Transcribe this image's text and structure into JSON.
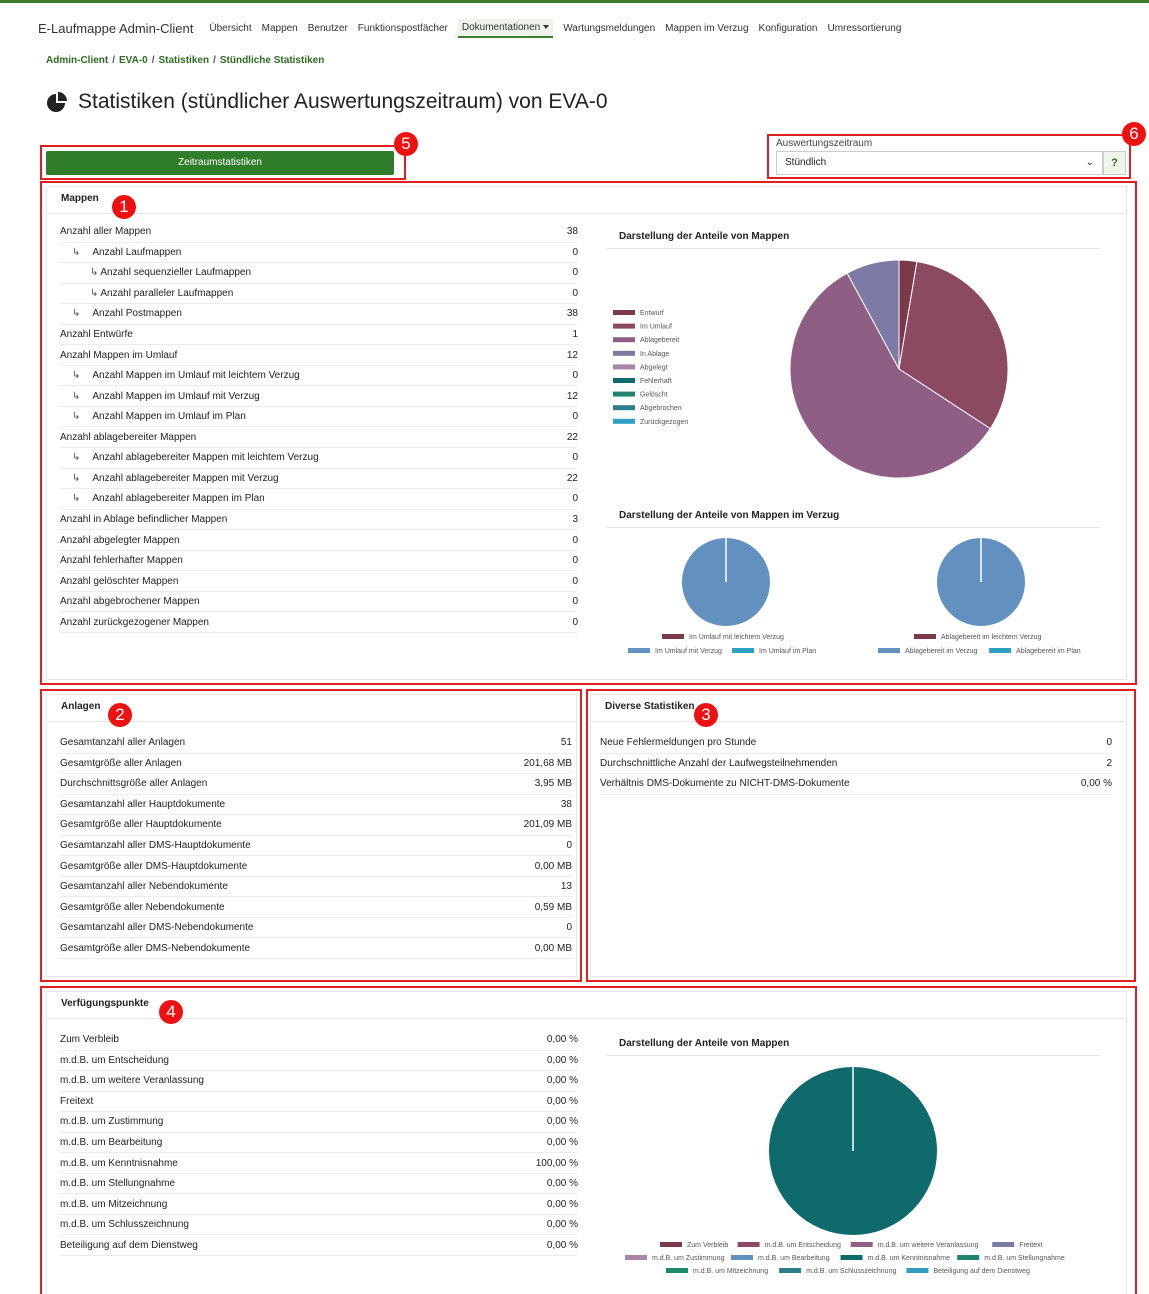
{
  "nav": {
    "brand": "E-Laufmappe Admin-Client",
    "items": [
      "Übersicht",
      "Mappen",
      "Benutzer",
      "Funktionspostfächer",
      "Dokumentationen",
      "Wartungsmeldungen",
      "Mappen im Verzug",
      "Konfiguration",
      "Umressortierung"
    ],
    "active_index": 4
  },
  "breadcrumb": [
    "Admin-Client",
    "EVA-0",
    "Statistiken",
    "Stündliche Statistiken"
  ],
  "page_title": "Statistiken (stündlicher Auswertungszeitraum) von EVA-0",
  "buttons": {
    "period_stats": "Zeitraumstatistiken"
  },
  "period": {
    "label": "Auswertungszeitraum",
    "value": "Stündlich",
    "help": "?"
  },
  "markers": [
    "1",
    "2",
    "3",
    "4",
    "5",
    "6"
  ],
  "colors": {
    "accent": "#2f7d2b",
    "highlight": "#e02020",
    "pie_1": [
      "#7b3a4a",
      "#8b4a62",
      "#8e5e85",
      "#7e7aa6",
      "#a985a8",
      "#0f6b6b",
      "#21846f",
      "#2d7d8c",
      "#2fa0c1"
    ],
    "pie_2": [
      "#7b3a4a",
      "#6291bf",
      "#2fa0c1"
    ],
    "pie_4": [
      "#7b3a4a",
      "#8b4a62",
      "#8e5e85",
      "#7e7aa6",
      "#a985a8",
      "#6291bf",
      "#0f6b6b",
      "#21846f",
      "#1f8a6a",
      "#2d7d8c",
      "#2fa0c1"
    ]
  },
  "mappen": {
    "header": "Mappen",
    "rows": [
      {
        "label": "Anzahl aller Mappen",
        "value": "38",
        "indent": 0
      },
      {
        "label": "Anzahl Laufmappen",
        "value": "0",
        "indent": 1
      },
      {
        "label": "Anzahl sequenzieller Laufmappen",
        "value": "0",
        "indent": 2
      },
      {
        "label": "Anzahl paralleler Laufmappen",
        "value": "0",
        "indent": 2
      },
      {
        "label": "Anzahl Postmappen",
        "value": "38",
        "indent": 1
      },
      {
        "label": "Anzahl Entwürfe",
        "value": "1",
        "indent": 0
      },
      {
        "label": "Anzahl Mappen im Umlauf",
        "value": "12",
        "indent": 0
      },
      {
        "label": "Anzahl Mappen im Umlauf mit leichtem Verzug",
        "value": "0",
        "indent": 1
      },
      {
        "label": "Anzahl Mappen im Umlauf mit Verzug",
        "value": "12",
        "indent": 1
      },
      {
        "label": "Anzahl Mappen im Umlauf im Plan",
        "value": "0",
        "indent": 1
      },
      {
        "label": "Anzahl ablagebereiter Mappen",
        "value": "22",
        "indent": 0
      },
      {
        "label": "Anzahl ablagebereiter Mappen mit leichtem Verzug",
        "value": "0",
        "indent": 1
      },
      {
        "label": "Anzahl ablagebereiter Mappen mit Verzug",
        "value": "22",
        "indent": 1
      },
      {
        "label": "Anzahl ablagebereiter Mappen im Plan",
        "value": "0",
        "indent": 1
      },
      {
        "label": "Anzahl in Ablage befindlicher Mappen",
        "value": "3",
        "indent": 0
      },
      {
        "label": "Anzahl abgelegter Mappen",
        "value": "0",
        "indent": 0
      },
      {
        "label": "Anzahl fehlerhafter Mappen",
        "value": "0",
        "indent": 0
      },
      {
        "label": "Anzahl gelöschter Mappen",
        "value": "0",
        "indent": 0
      },
      {
        "label": "Anzahl abgebrochener Mappen",
        "value": "0",
        "indent": 0
      },
      {
        "label": "Anzahl zurückgezogener Mappen",
        "value": "0",
        "indent": 0
      }
    ]
  },
  "anlagen": {
    "header": "Anlagen",
    "rows": [
      {
        "label": "Gesamtanzahl aller Anlagen",
        "value": "51"
      },
      {
        "label": "Gesamtgröße aller Anlagen",
        "value": "201,68 MB"
      },
      {
        "label": "Durchschnittsgröße aller Anlagen",
        "value": "3,95 MB"
      },
      {
        "label": "Gesamtanzahl aller Hauptdokumente",
        "value": "38"
      },
      {
        "label": "Gesamtgröße aller Hauptdokumente",
        "value": "201,09 MB"
      },
      {
        "label": "Gesamtanzahl aller DMS-Hauptdokumente",
        "value": "0"
      },
      {
        "label": "Gesamtgröße aller DMS-Hauptdokumente",
        "value": "0,00 MB"
      },
      {
        "label": "Gesamtanzahl aller Nebendokumente",
        "value": "13"
      },
      {
        "label": "Gesamtgröße aller Nebendokumente",
        "value": "0,59 MB"
      },
      {
        "label": "Gesamtanzahl aller DMS-Nebendokumente",
        "value": "0"
      },
      {
        "label": "Gesamtgröße aller DMS-Nebendokumente",
        "value": "0,00 MB"
      }
    ]
  },
  "diverse": {
    "header": "Diverse Statistiken",
    "rows": [
      {
        "label": "Neue Fehlermeldungen pro Stunde",
        "value": "0"
      },
      {
        "label": "Durchschnittliche Anzahl der Laufwegsteilnehmenden",
        "value": "2"
      },
      {
        "label": "Verhältnis DMS-Dokumente zu NICHT-DMS-Dokumente",
        "value": "0,00 %"
      }
    ]
  },
  "verfuegung": {
    "header": "Verfügungspunkte",
    "rows": [
      {
        "label": "Zum Verbleib",
        "value": "0,00 %"
      },
      {
        "label": "m.d.B. um Entscheidung",
        "value": "0,00 %"
      },
      {
        "label": "m.d.B. um weitere Veranlassung",
        "value": "0,00 %"
      },
      {
        "label": "Freitext",
        "value": "0,00 %"
      },
      {
        "label": "m.d.B. um Zustimmung",
        "value": "0,00 %"
      },
      {
        "label": "m.d.B. um Bearbeitung",
        "value": "0,00 %"
      },
      {
        "label": "m.d.B. um Kenntnisnahme",
        "value": "100,00 %"
      },
      {
        "label": "m.d.B. um Stellungnahme",
        "value": "0,00 %"
      },
      {
        "label": "m.d.B. um Mitzeichnung",
        "value": "0,00 %"
      },
      {
        "label": "m.d.B. um Schlusszeichnung",
        "value": "0,00 %"
      },
      {
        "label": "Beteiligung auf dem Dienstweg",
        "value": "0,00 %"
      }
    ]
  },
  "chart_data": [
    {
      "type": "pie",
      "title": "Darstellung der Anteile von Mappen",
      "labels": [
        "Entwurf",
        "Im Umlauf",
        "Ablagebereit",
        "In Ablage",
        "Abgelegt",
        "Fehlerhaft",
        "Gelöscht",
        "Abgebrochen",
        "Zurückgezogen"
      ],
      "values": [
        1,
        12,
        22,
        3,
        0,
        0,
        0,
        0,
        0
      ],
      "legend": "left"
    },
    {
      "type": "pie",
      "title": "Darstellung der Anteile von Mappen im Verzug",
      "labels": [
        "Im Umlauf mit leichtem Verzug",
        "Im Umlauf mit Verzug",
        "Im Umlauf im Plan"
      ],
      "values": [
        0,
        12,
        0
      ],
      "legend": "bottom"
    },
    {
      "type": "pie",
      "title": "",
      "labels": [
        "Ablagebereit im leichtem Verzug",
        "Ablagebereit im Verzug",
        "Ablagebereit im Plan"
      ],
      "values": [
        0,
        22,
        0
      ],
      "legend": "bottom"
    },
    {
      "type": "pie",
      "title": "Darstellung der Anteile von Mappen",
      "labels": [
        "Zum Verbleib",
        "m.d.B. um Entscheidung",
        "m.d.B. um weitere Veranlassung",
        "Freitext",
        "m.d.B. um Zustimmung",
        "m.d.B. um Bearbeitung",
        "m.d.B. um Kenntnisnahme",
        "m.d.B. um Stellungnahme",
        "m.d.B. um Mitzeichnung",
        "m.d.B. um Schlusszeichnung",
        "Beteiligung auf dem Dienstweg"
      ],
      "values": [
        0,
        0,
        0,
        0,
        0,
        0,
        100,
        0,
        0,
        0,
        0
      ],
      "legend": "bottom"
    }
  ]
}
